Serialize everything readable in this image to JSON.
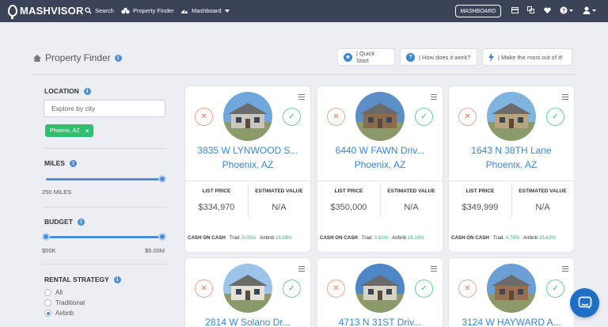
{
  "nav": {
    "logo": "MASHVISOR",
    "search": "Search",
    "property_finder": "Property Finder",
    "mashboard_menu": "Mashboard",
    "mashboard_button": "MASHBOARD"
  },
  "header": {
    "title": "Property Finder",
    "quick_start": "| Quick Start",
    "how_it_works": "| How does it work?",
    "make_most": "| Make the most out of it!"
  },
  "filters": {
    "location_label": "LOCATION",
    "city_placeholder": "Explore by city",
    "chip": "Phoenix, AZ",
    "miles_label": "MILES",
    "miles_value": "250 MILES",
    "miles_level": 1.0,
    "budget_label": "BUDGET",
    "budget_min": "$50K",
    "budget_max": "$5.00M",
    "budget_range": [
      0.0,
      1.0
    ],
    "strategy_label": "RENTAL STRATEGY",
    "strategies": [
      {
        "label": "All",
        "selected": false
      },
      {
        "label": "Traditional",
        "selected": false
      },
      {
        "label": "Airbnb",
        "selected": true
      }
    ]
  },
  "labels": {
    "list_price": "LIST PRICE",
    "estimated_value": "ESTIMATED VALUE",
    "cash_on_cash": "CASH ON CASH",
    "trad": "Trad.",
    "airbnb": "Airbnb"
  },
  "cards": [
    {
      "address": "3835 W LYNWOOD S...",
      "city": "Phoenix, AZ",
      "list_price": "$334,970",
      "estimated_value": "N/A",
      "trad": "5.05%",
      "airbnb": "16.18%"
    },
    {
      "address": "6440 W FAWN Driv...",
      "city": "Phoenix, AZ",
      "list_price": "$350,000",
      "estimated_value": "N/A",
      "trad": "0.62%",
      "airbnb": "16.16%"
    },
    {
      "address": "1643 N 38TH Lane",
      "city": "Phoenix, AZ",
      "list_price": "$349,999",
      "estimated_value": "N/A",
      "trad": "4.76%",
      "airbnb": "15.43%"
    },
    {
      "address": "2814 W Solano Dr..."
    },
    {
      "address": "4713 N 31ST Driv..."
    },
    {
      "address": "3124 W HAYWARD A..."
    }
  ],
  "colors": {
    "nav_bg": "#3b4358",
    "accent_blue": "#3a87d0",
    "green": "#2fbf71",
    "reject": "#ee7a5a"
  },
  "icons": {
    "search": "search-icon",
    "property_finder": "binoculars-icon",
    "mashboard": "dashboard-icon",
    "chat": "chat-icon"
  }
}
